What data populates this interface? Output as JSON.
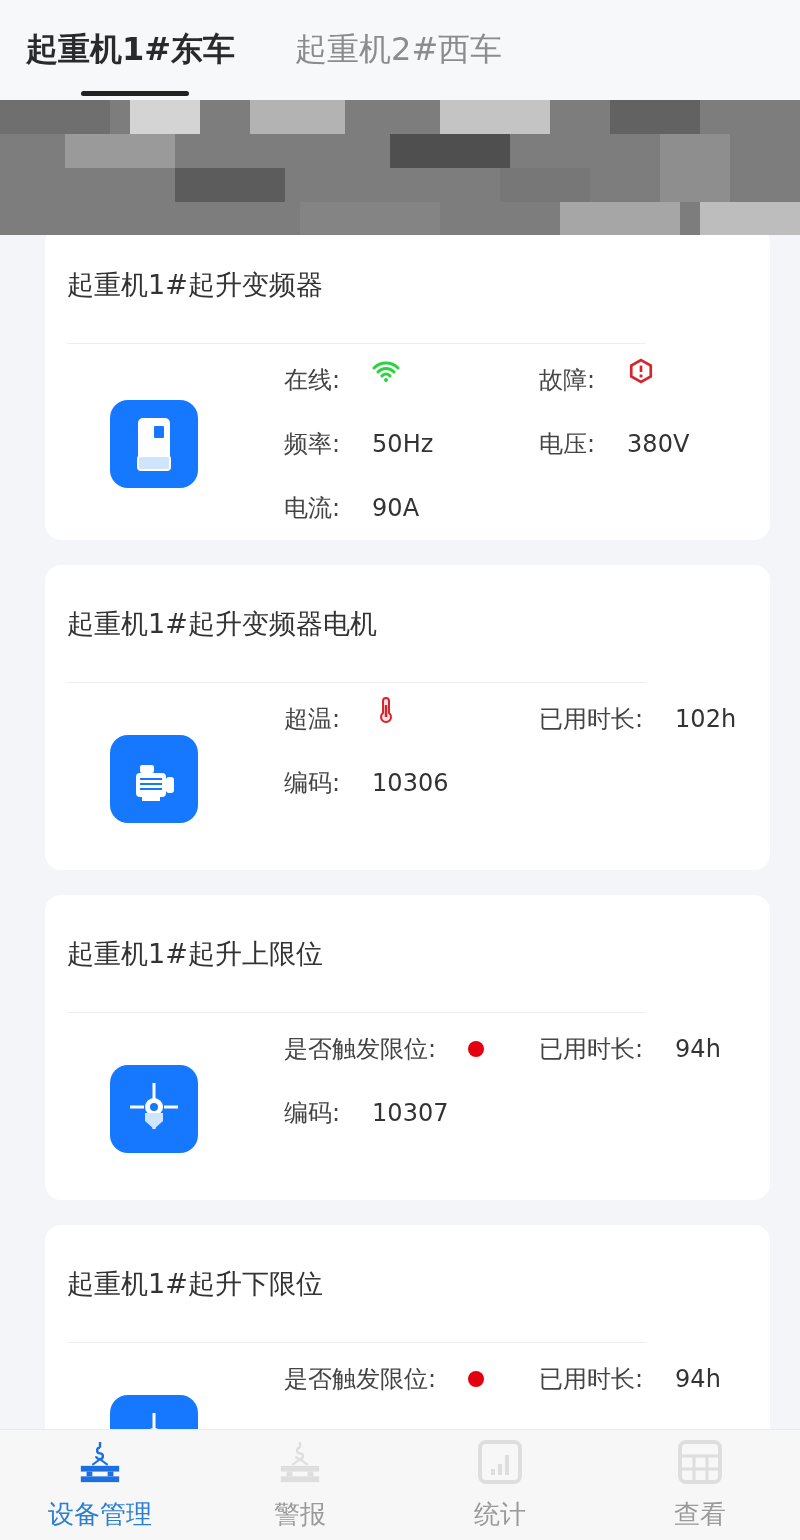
{
  "tabs": [
    {
      "label": "起重机1#东车",
      "selected": true
    },
    {
      "label": "起重机2#西车",
      "selected": false
    }
  ],
  "devices": [
    {
      "title": "起重机1#起升变频器",
      "kind": "inverter",
      "fields": [
        {
          "label": "在线:",
          "kind": "wifi",
          "on": true
        },
        {
          "label": "故障:",
          "kind": "alarm",
          "on": true
        },
        {
          "label": "频率:",
          "kind": "value",
          "value": "50Hz"
        },
        {
          "label": "电压:",
          "kind": "value",
          "value": "380V"
        },
        {
          "label": "电流:",
          "kind": "value",
          "value": "90A"
        }
      ]
    },
    {
      "title": "起重机1#起升变频器电机",
      "kind": "motor",
      "fields": [
        {
          "label": "超温:",
          "kind": "thermo",
          "on": true
        },
        {
          "label": "已用时长:",
          "kind": "value",
          "value": "102h"
        },
        {
          "label": "编码:",
          "kind": "value",
          "value": "10306"
        }
      ]
    },
    {
      "title": "起重机1#起升上限位",
      "kind": "limit",
      "fields": [
        {
          "label": "是否触发限位:",
          "kind": "dot",
          "on": true
        },
        {
          "label": "已用时长:",
          "kind": "value",
          "value": "94h"
        },
        {
          "label": "编码:",
          "kind": "value",
          "value": "10307"
        }
      ]
    },
    {
      "title": "起重机1#起升下限位",
      "kind": "limit",
      "fields": [
        {
          "label": "是否触发限位:",
          "kind": "dot",
          "on": true
        },
        {
          "label": "已用时长:",
          "kind": "value",
          "value": "94h"
        }
      ]
    }
  ],
  "nav": [
    {
      "label": "设备管理",
      "kind": "crane",
      "selected": true
    },
    {
      "label": "警报",
      "kind": "crane",
      "selected": false
    },
    {
      "label": "统计",
      "kind": "chart",
      "selected": false
    },
    {
      "label": "查看",
      "kind": "table",
      "selected": false
    }
  ]
}
